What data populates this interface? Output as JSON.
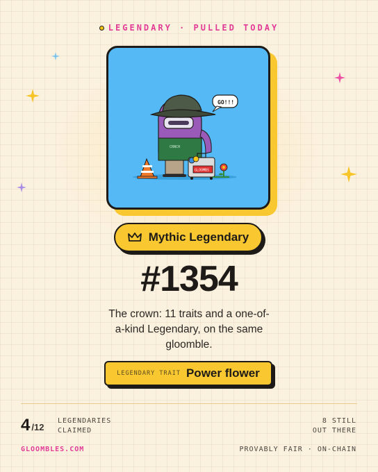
{
  "header": {
    "eyebrow": "LEGENDARY · PULLED TODAY"
  },
  "card": {
    "speech_bubble": "GO!!!",
    "sign_text": "GLOOMBS",
    "shirt_text": "CRNCH"
  },
  "badge": {
    "label": "Mythic Legendary",
    "icon": "crown-icon"
  },
  "token": {
    "number": "#1354"
  },
  "description": "The crown: 11 traits and a one-of-a-kind Legendary, on the same gloomble.",
  "trait": {
    "label": "LEGENDARY TRAIT",
    "value": "Power flower"
  },
  "stats": {
    "claimed_count": "4",
    "claimed_total": "/12",
    "claimed_label_1": "LEGENDARIES",
    "claimed_label_2": "CLAIMED",
    "remaining_1": "8 STILL",
    "remaining_2": "OUT THERE"
  },
  "footer": {
    "site": "GLOOMBLES.COM",
    "tagline": "PROVABLY FAIR · ON-CHAIN"
  },
  "colors": {
    "background": "#fbf1df",
    "accent_pink": "#e23b96",
    "accent_yellow": "#f9c830",
    "card_blue": "#54b9f5",
    "ink": "#1d1a17"
  }
}
